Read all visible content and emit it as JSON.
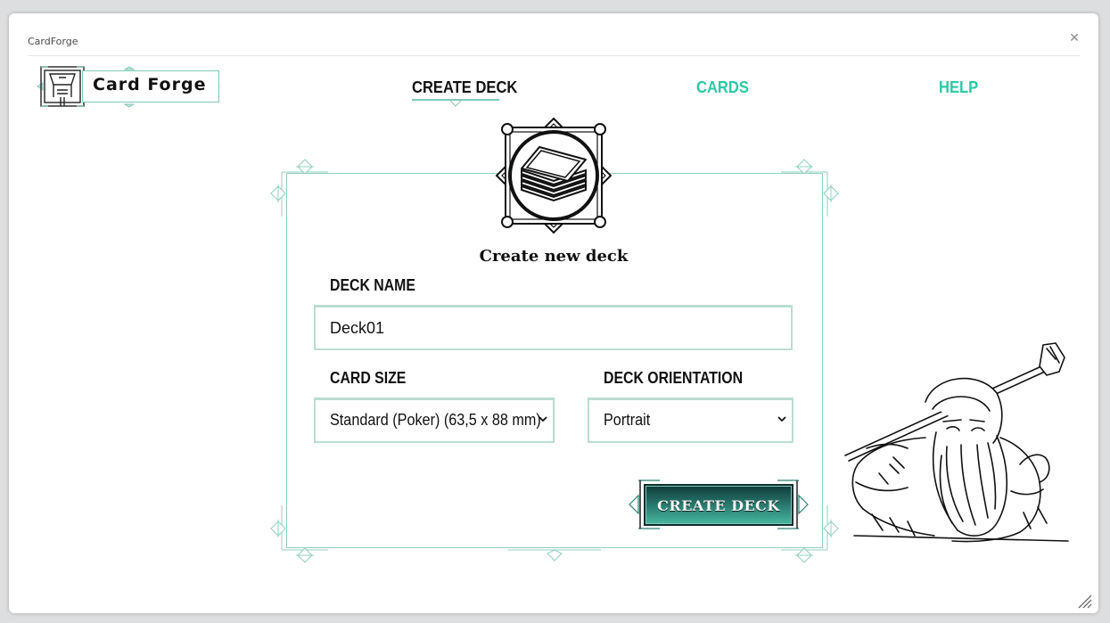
{
  "window": {
    "title": "CardForge",
    "close_icon": "close-icon"
  },
  "logo": {
    "text": "Card Forge",
    "icon": "forge-emblem-icon"
  },
  "nav": {
    "items": [
      {
        "label": "CREATE DECK",
        "active": true
      },
      {
        "label": "CARDS",
        "active": false
      },
      {
        "label": "HELP",
        "active": false
      }
    ]
  },
  "form": {
    "emblem_icon": "card-deck-icon",
    "title": "Create new deck",
    "deck_name": {
      "label": "DECK NAME",
      "value": "Deck01"
    },
    "card_size": {
      "label": "CARD SIZE",
      "selected": "Standard (Poker) (63,5 x 88 mm)"
    },
    "deck_orientation": {
      "label": "DECK ORIENTATION",
      "selected": "Portrait"
    },
    "submit_label": "CREATE DECK"
  },
  "illustration": {
    "icon": "dwarf-warrior-illustration"
  },
  "colors": {
    "accent": "#2ac9a6",
    "frame": "#8fd0c0",
    "button": "#2b7f73",
    "text": "#111111"
  }
}
